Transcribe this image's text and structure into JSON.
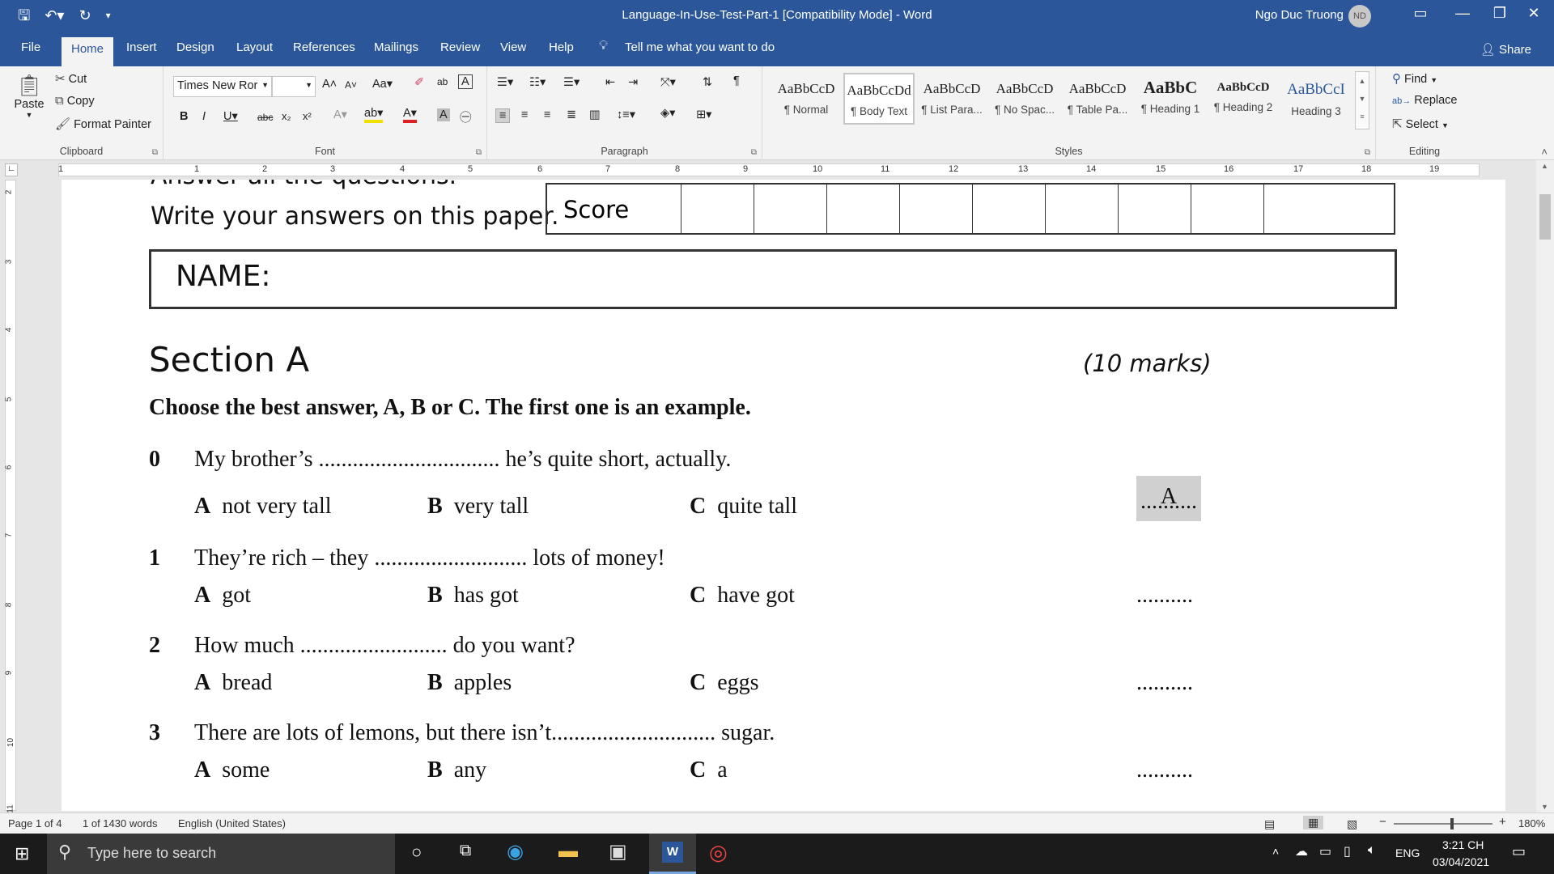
{
  "titlebar": {
    "title": "Language-In-Use-Test-Part-1 [Compatibility Mode]  -  Word",
    "user": "Ngo Duc Truong",
    "user_initials": "ND"
  },
  "tabs": [
    "File",
    "Home",
    "Insert",
    "Design",
    "Layout",
    "References",
    "Mailings",
    "Review",
    "View",
    "Help"
  ],
  "tell_me": "Tell me what you want to do",
  "share": "Share",
  "ribbon": {
    "clipboard": {
      "label": "Clipboard",
      "paste": "Paste",
      "cut": "Cut",
      "copy": "Copy",
      "format_painter": "Format Painter"
    },
    "font": {
      "label": "Font",
      "font_name": "Times New Ror",
      "font_size": ""
    },
    "paragraph": {
      "label": "Paragraph"
    },
    "styles": {
      "label": "Styles",
      "items": [
        {
          "sample": "AaBbCcD",
          "name": "¶ Normal"
        },
        {
          "sample": "AaBbCcDd",
          "name": "¶ Body Text"
        },
        {
          "sample": "AaBbCcD",
          "name": "¶ List Para..."
        },
        {
          "sample": "AaBbCcD",
          "name": "¶ No Spac..."
        },
        {
          "sample": "AaBbCcD",
          "name": "¶ Table Pa..."
        },
        {
          "sample": "AaBbC",
          "name": "¶ Heading 1"
        },
        {
          "sample": "AaBbCcD",
          "name": "¶ Heading 2"
        },
        {
          "sample": "AaBbCcI",
          "name": "Heading 3"
        }
      ]
    },
    "editing": {
      "label": "Editing",
      "find": "Find",
      "replace": "Replace",
      "select": "Select"
    }
  },
  "ruler_h": [
    "1",
    "1",
    "2",
    "3",
    "4",
    "5",
    "6",
    "7",
    "8",
    "9",
    "10",
    "11",
    "12",
    "13",
    "14",
    "15",
    "16",
    "17",
    "18",
    "19"
  ],
  "ruler_v": [
    "2",
    "3",
    "4",
    "5",
    "6",
    "7",
    "8",
    "9",
    "10",
    "11"
  ],
  "document": {
    "instruction_top": "Answer all the questions.",
    "instruction_write": "Write your answers on this paper.",
    "score_label": "Score",
    "name_label": "NAME:",
    "section_title": "Section A",
    "section_marks": "(10 marks)",
    "directions": "Choose the best answer, A, B or C. The first one is an example.",
    "questions": [
      {
        "num": "0",
        "stem": "My brother’s ................................ he’s quite short,  actually.",
        "a": "not very tall",
        "b": "very tall",
        "c": "quite tall",
        "answer": "A",
        "blank": ".........."
      },
      {
        "num": "1",
        "stem": "They’re rich – they ........................... lots of money!",
        "a": "got",
        "b": "has got",
        "c": "have got",
        "answer": "",
        "blank": ".........."
      },
      {
        "num": "2",
        "stem": "How much .......................... do you want?",
        "a": "bread",
        "b": "apples",
        "c": "eggs",
        "answer": "",
        "blank": ".........."
      },
      {
        "num": "3",
        "stem": "There are lots of lemons, but there isn’t............................. sugar.",
        "a": "some",
        "b": "any",
        "c": "a",
        "answer": "",
        "blank": ".........."
      }
    ],
    "letters": {
      "a": "A",
      "b": "B",
      "c": "C"
    }
  },
  "statusbar": {
    "page": "Page 1 of 4",
    "words": "1 of 1430 words",
    "language": "English (United States)",
    "zoom": "180%"
  },
  "taskbar": {
    "search_placeholder": "Type here to search",
    "lang": "ENG",
    "time": "3:21 CH",
    "date": "03/04/2021"
  }
}
